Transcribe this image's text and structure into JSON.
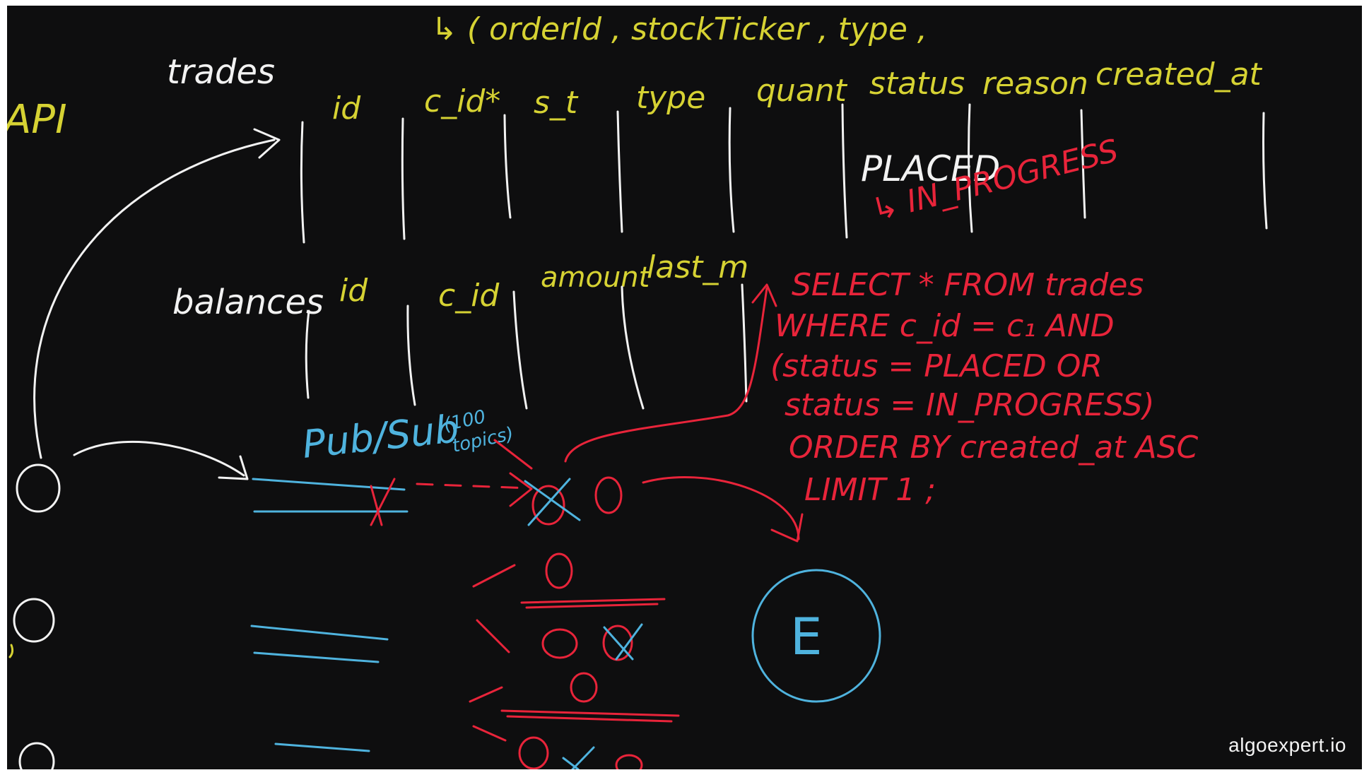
{
  "top_partial": "↳ ( orderId ,  stockTicker ,  type ,",
  "api_label": "API",
  "trades": {
    "label": "trades",
    "columns": [
      "id",
      "c_id*",
      "s_t",
      "type",
      "quant",
      "status",
      "reason",
      "created_at"
    ],
    "placed": "PLACED",
    "in_progress": "↳ IN_PROGRESS"
  },
  "balances": {
    "label": "balances",
    "columns": [
      "id",
      "c_id",
      "amount",
      "last_m"
    ]
  },
  "query": {
    "lines": [
      "SELECT * FROM trades",
      "WHERE c_id = c₁ AND",
      "(status = PLACED OR",
      "status = IN_PROGRESS)",
      "ORDER BY created_at ASC",
      "LIMIT 1 ;"
    ]
  },
  "pubsub": {
    "label": "Pub/Sub",
    "note_line1": "(100",
    "note_line2": "topics)"
  },
  "engine_label": "E",
  "watermark": "algoexpert.io",
  "colors": {
    "background": "#0e0e0f",
    "yellow": "#d6d233",
    "white": "#f2f2f2",
    "red": "#e8243a",
    "blue": "#4fb3de"
  }
}
